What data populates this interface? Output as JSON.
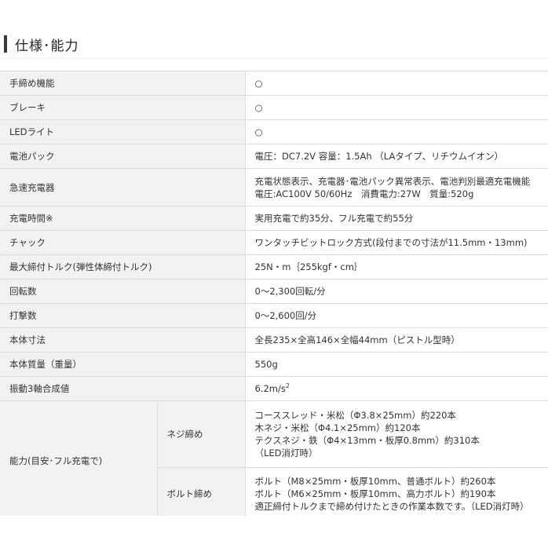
{
  "section": {
    "title": "仕様･能力"
  },
  "rows": [
    {
      "label": "手締め機能",
      "value": "○"
    },
    {
      "label": "ブレーキ",
      "value": "○"
    },
    {
      "label": "LEDライト",
      "value": "○"
    },
    {
      "label": "電池パック",
      "value": "電圧：DC7.2V 容量：1.5Ah （LAタイプ、リチウムイオン）"
    },
    {
      "label": "急速充電器",
      "lines": [
        "充電状態表示、充電器･電池パック異常表示、電池判別最適充電機能",
        "電圧:AC100V 50/60Hz　消費電力:27W　質量:520g"
      ]
    },
    {
      "label": "充電時間※",
      "value": "実用充電で約35分、フル充電で約55分"
    },
    {
      "label": "チャック",
      "value": "ワンタッチビットロック方式(段付までの寸法が11.5mm・13mm)"
    },
    {
      "label": "最大締付トルク(弾性体締付トルク)",
      "value": "25N・m｛255kgf・cm｝"
    },
    {
      "label": "回転数",
      "value": "0～2,300回転/分"
    },
    {
      "label": "打撃数",
      "value": "0～2,600回/分"
    },
    {
      "label": "本体寸法",
      "value": "全長235×全高146×全幅44mm（ピストル型時）"
    },
    {
      "label": "本体質量（重量）",
      "value": "550g"
    },
    {
      "label": "振動3軸合成値",
      "value": "6.2m/s",
      "value_sup": "2"
    }
  ],
  "capacity": {
    "label": "能力(目安･フル充電で)",
    "screw": {
      "label": "ネジ締め",
      "lines": [
        "コーススレッド・米松（Φ3.8×25mm）約220本",
        "木ネジ・米松（Φ4.1×25mm）約120本",
        "テクスネジ・鉄（Φ4×13mm・板厚0.8mm）約310本",
        "（LED消灯時）"
      ]
    },
    "bolt": {
      "label": "ボルト締め",
      "lines": [
        "ボルト（M8×25mm・板厚10mm、普通ボルト）約260本",
        "ボルト（M6×25mm・板厚10mm、高力ボルト）約190本",
        "適正締付トルクまで締め付けたときの作業本数です。（LED消灯時）"
      ]
    }
  }
}
